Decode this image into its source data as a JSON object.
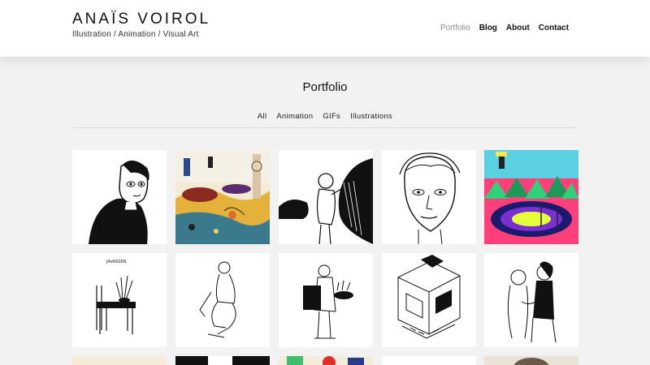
{
  "header": {
    "title": "ANAÏS VOIROL",
    "tagline": "Illustration / Animation / Visual Art",
    "nav": [
      {
        "label": "Portfolio",
        "active": true
      },
      {
        "label": "Blog",
        "active": false
      },
      {
        "label": "About",
        "active": false
      },
      {
        "label": "Contact",
        "active": false
      }
    ]
  },
  "main": {
    "heading": "Portfolio",
    "filters": [
      "All",
      "Animation",
      "GIFs",
      "Illustrations"
    ]
  },
  "colors": {
    "page_bg": "#f2f2f2",
    "header_bg": "#ffffff",
    "active_nav": "#8a8a8a"
  },
  "thumbnails": [
    {
      "icon": "portrait-black-dress-illustration"
    },
    {
      "icon": "colorful-landscape-figures-illustration"
    },
    {
      "icon": "figure-leaning-on-black-wave-illustration"
    },
    {
      "icon": "face-portrait-line-illustration"
    },
    {
      "icon": "neon-landscape-illustration"
    },
    {
      "icon": "chair-plant-sketch",
      "label": "JAVASSEN"
    },
    {
      "icon": "seated-figure-sketch"
    },
    {
      "icon": "standing-figure-sketch"
    },
    {
      "icon": "isometric-room-sketch"
    },
    {
      "icon": "two-figures-sketch"
    },
    {
      "icon": "partial-thumbnail-cream"
    },
    {
      "icon": "partial-thumbnail-dark"
    },
    {
      "icon": "partial-thumbnail-colorful"
    },
    {
      "icon": "partial-thumbnail-white"
    },
    {
      "icon": "partial-thumbnail-portrait"
    }
  ]
}
